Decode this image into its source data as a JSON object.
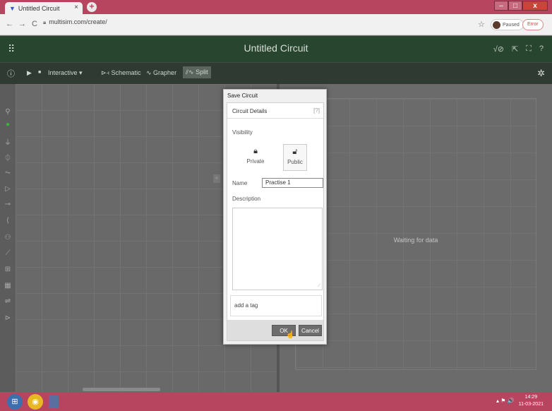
{
  "browser": {
    "tab_title": "Untitled Circuit",
    "tab_close": "×",
    "new_tab": "+",
    "url": "multisim.com/create/",
    "profile_status": "Paused",
    "error_label": "Error",
    "nav_back": "←",
    "nav_forward": "→",
    "nav_reload": "C",
    "star": "☆",
    "win_minimize": "‒",
    "win_maximize": "□",
    "win_close": "x"
  },
  "app": {
    "title": "Untitled Circuit",
    "header_icons": [
      "√⊘",
      "⇱",
      "⛶",
      "?"
    ]
  },
  "toolbar": {
    "info": "ⓘ",
    "play": "▶",
    "stop": "■",
    "mode": "Interactive ▾",
    "schematic": "Schematic",
    "grapher": "Grapher",
    "split": "Split",
    "settings": "✲"
  },
  "grapher": {
    "waiting_text": "Waiting for data"
  },
  "dialog": {
    "title": "Save Circuit",
    "section": "Circuit Details",
    "help": "[?]",
    "visibility_label": "Visibility",
    "private_label": "Private",
    "public_label": "Public",
    "name_label": "Name",
    "name_value": "Practise 1",
    "description_label": "Description",
    "description_value": "",
    "tag_placeholder": "add a tag",
    "ok_label": "OK",
    "cancel_label": "Cancel"
  },
  "taskbar": {
    "tray": "▴ ⚑ 🔊",
    "clock_time": "14:29",
    "clock_date": "11-03-2021"
  }
}
